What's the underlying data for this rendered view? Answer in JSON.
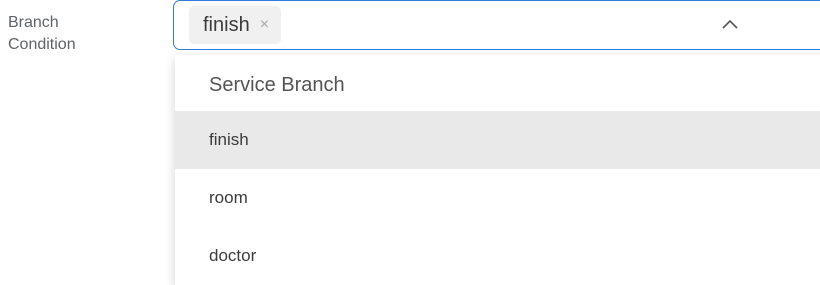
{
  "field": {
    "label_line1": "Branch",
    "label_line2": "Condition"
  },
  "select": {
    "selected_tags": [
      {
        "label": "finish",
        "remove_icon": "close-icon",
        "remove_glyph": "×"
      }
    ],
    "toggle_icon": "chevron-up-icon",
    "accent_color": "#2f7de1"
  },
  "dropdown": {
    "group_title": "Service Branch",
    "options": [
      {
        "label": "finish",
        "selected": true
      },
      {
        "label": "room",
        "selected": false
      },
      {
        "label": "doctor",
        "selected": false
      }
    ]
  }
}
